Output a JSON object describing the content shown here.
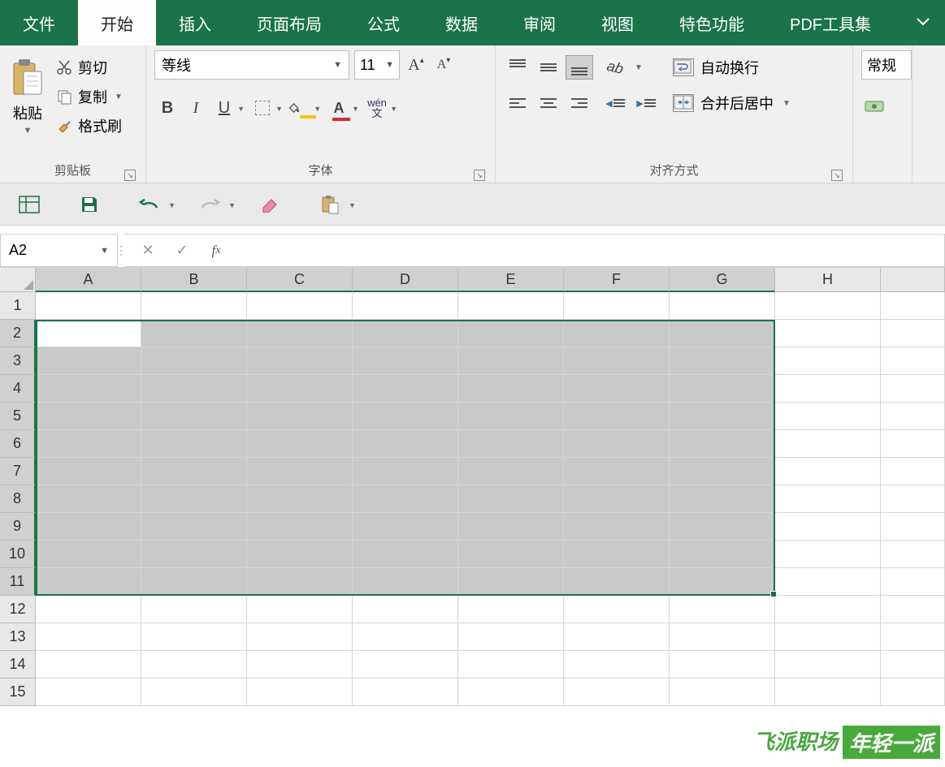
{
  "menubar": {
    "tabs": [
      "文件",
      "开始",
      "插入",
      "页面布局",
      "公式",
      "数据",
      "审阅",
      "视图",
      "特色功能",
      "PDF工具集"
    ],
    "activeIndex": 1
  },
  "ribbon": {
    "clipboard": {
      "paste": "粘贴",
      "cut": "剪切",
      "copy": "复制",
      "fmtPainter": "格式刷",
      "groupLabel": "剪贴板"
    },
    "font": {
      "name": "等线",
      "size": "11",
      "groupLabel": "字体",
      "wenTop": "wén",
      "wenBottom": "文"
    },
    "alignment": {
      "wrap": "自动换行",
      "merge": "合并后居中",
      "groupLabel": "对齐方式"
    },
    "number": {
      "format": "常规"
    }
  },
  "formulaBar": {
    "nameBox": "A2",
    "formula": ""
  },
  "sheet": {
    "columns": [
      "A",
      "B",
      "C",
      "D",
      "E",
      "F",
      "G",
      "H"
    ],
    "rows": [
      "1",
      "2",
      "3",
      "4",
      "5",
      "6",
      "7",
      "8",
      "9",
      "10",
      "11",
      "12",
      "13",
      "14",
      "15"
    ],
    "selectedColsEnd": 7,
    "selectedRowStart": 2,
    "selectedRowEnd": 11,
    "activeCell": "A2"
  },
  "watermark": {
    "left": "飞派职场",
    "right": "年轻一派"
  }
}
